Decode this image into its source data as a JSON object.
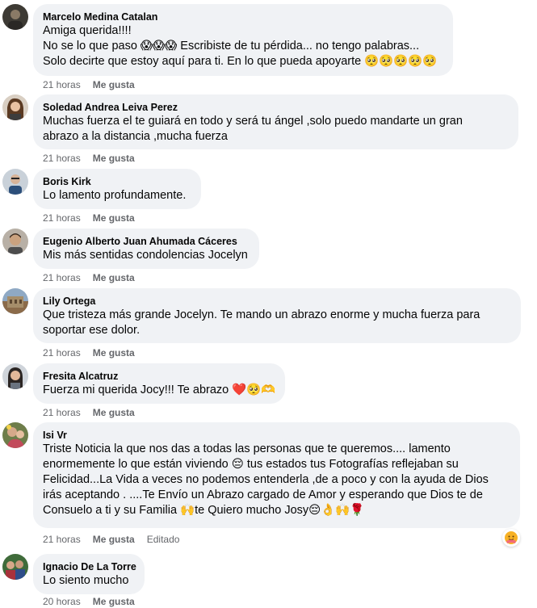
{
  "comments": [
    {
      "author": "Marcelo Medina Catalan",
      "lines": [
        "Amiga querida!!!!",
        "No se lo que paso 😱😱😱 Escribiste de tu pérdida... no tengo palabras...",
        "Solo decirte que estoy aquí para ti. En lo que pueda apoyarte 🥺🥺🥺🥺🥺"
      ],
      "time": "21 horas",
      "like": "Me gusta"
    },
    {
      "author": "Soledad Andrea Leiva Perez",
      "lines": [
        "Muchas fuerza el te guiará en todo y será tu ángel ,solo puedo mandarte un gran",
        "abrazo a la distancia ,mucha fuerza"
      ],
      "time": "21 horas",
      "like": "Me gusta"
    },
    {
      "author": "Boris Kirk",
      "lines": [
        "Lo lamento profundamente."
      ],
      "time": "21 horas",
      "like": "Me gusta"
    },
    {
      "author": "Eugenio Alberto Juan Ahumada Cáceres",
      "lines": [
        "Mis más sentidas condolencias Jocelyn"
      ],
      "time": "21 horas",
      "like": "Me gusta"
    },
    {
      "author": "Lily Ortega",
      "lines": [
        "Que tristeza más grande Jocelyn. Te mando un abrazo enorme y mucha fuerza para",
        "soportar ese dolor."
      ],
      "time": "21 horas",
      "like": "Me gusta"
    },
    {
      "author": "Fresita Alcatruz",
      "lines": [
        "Fuerza mi querida Jocy!!! Te abrazo ❤️🥺🫶"
      ],
      "time": "21 horas",
      "like": "Me gusta"
    },
    {
      "author": "Isi Vr",
      "lines": [
        "Triste Noticia la que nos das a todas las personas que te queremos.... lamento",
        "enormemente lo que están viviendo 😔 tus estados tus Fotografías reflejaban su",
        "Felicidad...La Vida a veces no podemos entenderla ,de a poco y con la ayuda de Dios",
        "irás aceptando . ....Te Envío un Abrazo cargado de Amor y esperando que Dios te de",
        "Consuelo a ti y su Familia 🙌te Quiero mucho Josy😔👌🙌🌹"
      ],
      "time": "21 horas",
      "like": "Me gusta",
      "edited": "Editado",
      "reaction": "care-reaction"
    },
    {
      "author": "Ignacio De La Torre",
      "lines": [
        "Lo siento mucho"
      ],
      "time": "20 horas",
      "like": "Me gusta"
    }
  ],
  "colors": {
    "bubble": "#f0f2f5",
    "meta": "#65676b",
    "text": "#050505"
  }
}
